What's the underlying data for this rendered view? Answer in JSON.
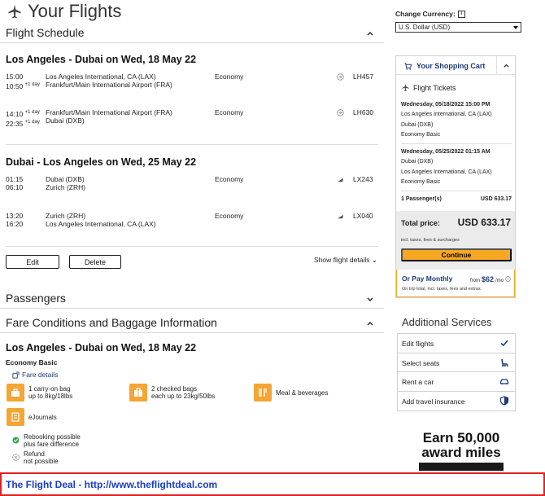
{
  "page": {
    "title": "Your Flights"
  },
  "flight_schedule": {
    "title": "Flight Schedule",
    "outbound": {
      "route": "Los Angeles - Dubai on Wed, 18 May 22",
      "legs": [
        {
          "dep_time": "15:00",
          "arr_time": "10:50",
          "arr_note": "+1 day",
          "dep_note": "",
          "from": "Los Angeles International, CA (LAX)",
          "to": "Frankfurt/Main International Airport (FRA)",
          "cabin": "Economy",
          "flight": "LH457"
        },
        {
          "dep_time": "14:10",
          "arr_time": "22:35",
          "dep_note": "+1 day",
          "arr_note": "+1 day",
          "from": "Frankfurt/Main International Airport (FRA)",
          "to": "Dubai (DXB)",
          "cabin": "Economy",
          "flight": "LH630"
        }
      ]
    },
    "return": {
      "route": "Dubai - Los Angeles on Wed, 25 May 22",
      "legs": [
        {
          "dep_time": "01:15",
          "arr_time": "06:10",
          "from": "Dubai (DXB)",
          "to": "Zurich (ZRH)",
          "cabin": "Economy",
          "flight": "LX243"
        },
        {
          "dep_time": "13:20",
          "arr_time": "16:20",
          "from": "Zurich (ZRH)",
          "to": "Los Angeles International, CA (LAX)",
          "cabin": "Economy",
          "flight": "LX040"
        }
      ]
    },
    "edit_label": "Edit",
    "delete_label": "Delete",
    "show_details_label": "Show flight details"
  },
  "passengers": {
    "title": "Passengers"
  },
  "fare": {
    "title": "Fare Conditions and Baggage Information",
    "route": "Los Angeles - Dubai on Wed, 18 May 22",
    "fare_name": "Economy Basic",
    "fare_details_link": "Fare details",
    "amenities": [
      {
        "line1": "1 carry-on bag",
        "line2": "up to 8kg/18lbs",
        "icon": "carry-on-bag-icon"
      },
      {
        "line1": "2 checked bags",
        "line2": "each up to 23kg/50lbs",
        "icon": "checked-bags-icon"
      },
      {
        "line1": "Meal & beverages",
        "line2": "",
        "icon": "meal-icon"
      },
      {
        "line1": "eJournals",
        "line2": "",
        "icon": "ejournals-icon"
      }
    ],
    "conditions": [
      {
        "line1": "Rebooking possible",
        "line2": "plus fare difference",
        "icon": "check-icon"
      },
      {
        "line1": "Refund",
        "line2": "not possible",
        "icon": "cross-icon"
      }
    ]
  },
  "sidebar": {
    "currency_label": "Change Currency:",
    "currency_info": "i",
    "currency_value": "U.S. Dollar (USD)",
    "cart_title": "Your Shopping Cart",
    "flight_tickets_label": "Flight Tickets",
    "itinerary": [
      {
        "datetime": "Wednesday, 05/18/2022 15:00 PM",
        "from": "Los Angeles International, CA (LAX)",
        "to": "Dubai (DXB)",
        "fare": "Economy Basic"
      },
      {
        "datetime": "Wednesday, 05/25/2022 01:15 AM",
        "from": "Dubai (DXB)",
        "to": "Los Angeles International, CA (LAX)",
        "fare": "Economy Basic"
      }
    ],
    "passengers_label": "1 Passenger(s)",
    "passengers_price": "USD 633.17",
    "total_label": "Total price:",
    "total_amount": "USD 633.17",
    "total_note": "incl. taxes, fees & surcharges",
    "continue_label": "Continue",
    "pay_monthly_label": "Or Pay Monthly",
    "pay_monthly_from": "from",
    "pay_monthly_amount": "$62",
    "pay_monthly_unit": "/mo",
    "pay_monthly_note": "On trip total, incl. taxes, fees and extras.",
    "additional_title": "Additional Services",
    "services": [
      {
        "label": "Edit flights",
        "icon": "checkmark-icon"
      },
      {
        "label": "Select seats",
        "icon": "seat-icon"
      },
      {
        "label": "Rent a car",
        "icon": "car-icon"
      },
      {
        "label": "Add travel insurance",
        "icon": "shield-icon"
      }
    ],
    "promo_line1": "Earn 50,000",
    "promo_line2": "award miles"
  },
  "banner": {
    "text": "The Flight Deal - http://www.theflightdeal.com"
  },
  "colors": {
    "accent": "#f7a823",
    "brand_blue": "#1e3a78",
    "banner_border": "#e02020",
    "banner_text": "#1a3cc8"
  }
}
